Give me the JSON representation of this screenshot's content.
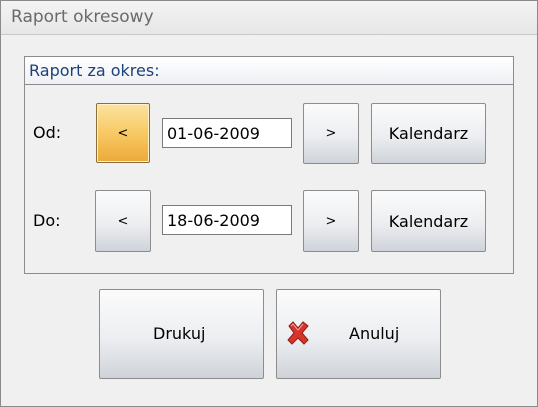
{
  "window": {
    "title": "Raport okresowy"
  },
  "group": {
    "title": "Raport za okres:"
  },
  "from": {
    "label": "Od:",
    "prev_label": "<",
    "date": "01-06-2009",
    "next_label": ">",
    "calendar_label": "Kalendarz"
  },
  "to": {
    "label": "Do:",
    "prev_label": "<",
    "date": "18-06-2009",
    "next_label": ">",
    "calendar_label": "Kalendarz"
  },
  "actions": {
    "print_label": "Drukuj",
    "cancel_label": "Anuluj"
  },
  "icons": {
    "cancel": "red-x-icon"
  },
  "colors": {
    "active_button": "#f8c964",
    "group_title": "#1e3f78",
    "cancel_icon": "#d9342b"
  }
}
